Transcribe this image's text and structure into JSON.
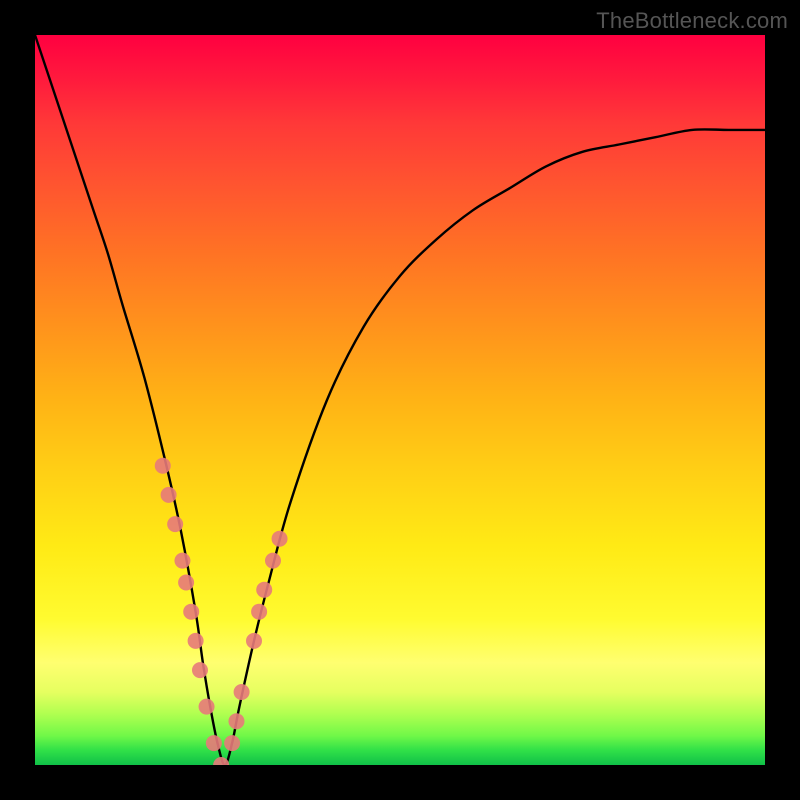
{
  "watermark": "TheBottleneck.com",
  "chart_data": {
    "type": "line",
    "title": "",
    "xlabel": "",
    "ylabel": "",
    "xlim": [
      0,
      100
    ],
    "ylim": [
      0,
      100
    ],
    "grid": false,
    "legend": false,
    "series": [
      {
        "name": "bottleneck-curve",
        "color": "#000000",
        "x": [
          0,
          2,
          5,
          8,
          10,
          12,
          15,
          18,
          20,
          22,
          23,
          24,
          25,
          26,
          27,
          28,
          30,
          32,
          35,
          40,
          45,
          50,
          55,
          60,
          65,
          70,
          75,
          80,
          85,
          90,
          95,
          100
        ],
        "y": [
          100,
          94,
          85,
          76,
          70,
          63,
          53,
          41,
          32,
          21,
          14,
          8,
          3,
          0,
          3,
          8,
          17,
          25,
          36,
          50,
          60,
          67,
          72,
          76,
          79,
          82,
          84,
          85,
          86,
          87,
          87,
          87
        ]
      },
      {
        "name": "left-branch-markers",
        "color": "#e77a7a",
        "type": "scatter",
        "x": [
          17.5,
          18.3,
          19.2,
          20.2,
          20.7,
          21.4,
          22.0,
          22.6,
          23.5,
          24.5,
          25.5
        ],
        "y": [
          41,
          37,
          33,
          28,
          25,
          21,
          17,
          13,
          8,
          3,
          0
        ]
      },
      {
        "name": "right-branch-markers",
        "color": "#e77a7a",
        "type": "scatter",
        "x": [
          27.0,
          27.6,
          28.3,
          30.0,
          30.7,
          31.4,
          32.6,
          33.5
        ],
        "y": [
          3,
          6,
          10,
          17,
          21,
          24,
          28,
          31
        ]
      }
    ]
  }
}
